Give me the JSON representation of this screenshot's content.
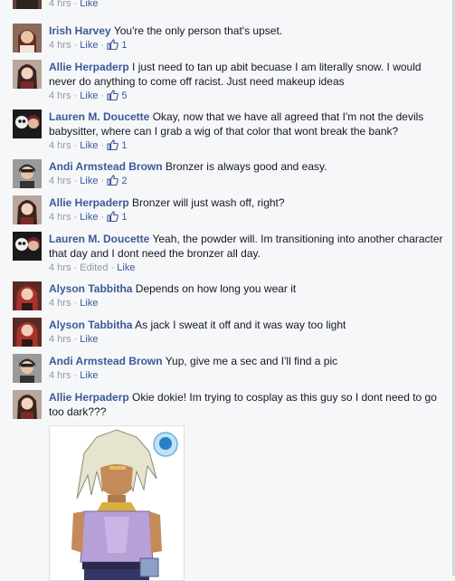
{
  "top_partial": {
    "time": "4 hrs",
    "like": "Like"
  },
  "comments": [
    {
      "author": "Irish Harvey",
      "text": "You're the only person that's upset.",
      "time": "4 hrs",
      "like": "Like",
      "likes": "1"
    },
    {
      "author": "Allie Herpaderp",
      "text": "I just need to tan up abit becuase I am literally snow. I would never do anything to come off racist. Just need makeup ideas",
      "time": "4 hrs",
      "like": "Like",
      "likes": "5"
    },
    {
      "author": "Lauren M. Doucette",
      "text": "Okay, now that we have all agreed that I'm not the devils babysitter, where can I grab a wig of that color that wont break the bank?",
      "time": "4 hrs",
      "like": "Like",
      "likes": "1"
    },
    {
      "author": "Andi Armstead Brown",
      "text": "Bronzer is always good and easy.",
      "time": "4 hrs",
      "like": "Like",
      "likes": "2"
    },
    {
      "author": "Allie Herpaderp",
      "text": "Bronzer will just wash off, right?",
      "time": "4 hrs",
      "like": "Like",
      "likes": "1"
    },
    {
      "author": "Lauren M. Doucette",
      "text": "Yeah, the powder will. Im transitioning into another character that day and I dont need the bronzer all day.",
      "time": "4 hrs",
      "edited": "Edited",
      "like": "Like"
    },
    {
      "author": "Alyson Tabbitha",
      "text": "Depends on how long you wear it",
      "time": "4 hrs",
      "like": "Like"
    },
    {
      "author": "Alyson Tabbitha",
      "text": "As jack I sweat it off and it was way too light",
      "time": "4 hrs",
      "like": "Like"
    },
    {
      "author": "Andi Armstead Brown",
      "text": "Yup, give me a sec and I'll find a pic",
      "time": "4 hrs",
      "like": "Like"
    },
    {
      "author": "Allie Herpaderp",
      "text": "Okie dokie! Im trying to cosplay as this guy so I dont need to go too dark???"
    }
  ],
  "colors": {
    "link": "#3b5998",
    "meta": "#9197a3",
    "text": "#141823",
    "bg": "#f6f7f9"
  }
}
